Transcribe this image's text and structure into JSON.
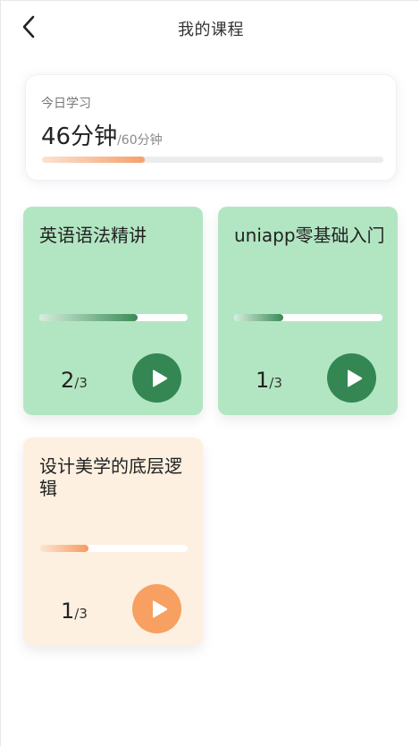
{
  "header": {
    "title": "我的课程",
    "back_icon": "chevron-left-icon"
  },
  "today": {
    "label": "今日学习",
    "minutes_text": "46分钟",
    "goal_text": "/60分钟",
    "progress": 0.3
  },
  "colors": {
    "green_card": "#b2e6c2",
    "green_button": "#348752",
    "orange_card": "#fdf0e0",
    "orange_button": "#f7a061",
    "today_progress": "#f6a06a"
  },
  "courses": [
    {
      "title": "英语语法精讲",
      "theme": "green",
      "progress": 0.66,
      "done": "2",
      "total": "3",
      "separator": "/",
      "play_icon": "play-icon"
    },
    {
      "title": "uniapp零基础入门",
      "theme": "green",
      "progress": 0.33,
      "done": "1",
      "total": "3",
      "separator": "/",
      "play_icon": "play-icon"
    },
    {
      "title": "设计美学的底层逻辑",
      "theme": "orange",
      "progress": 0.33,
      "done": "1",
      "total": "3",
      "separator": "/",
      "play_icon": "play-icon"
    }
  ]
}
